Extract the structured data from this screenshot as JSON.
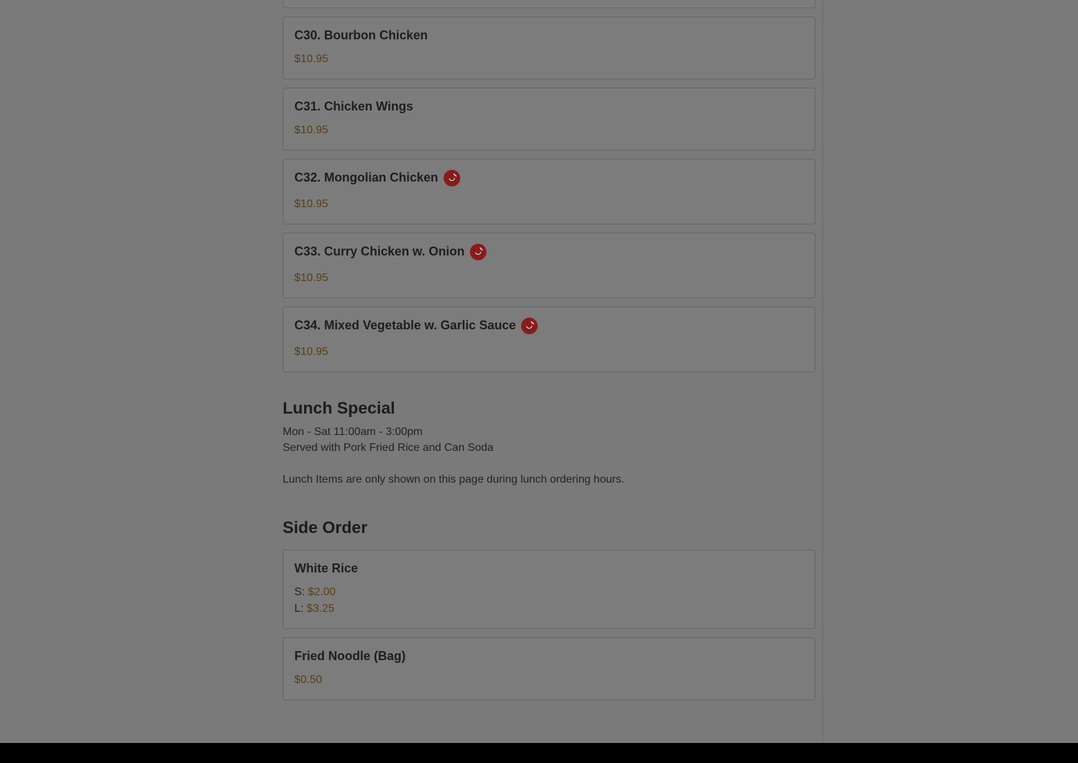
{
  "items": [
    {
      "name": "C30. Bourbon Chicken",
      "price": "$10.95",
      "spicy": false
    },
    {
      "name": "C31. Chicken Wings",
      "price": "$10.95",
      "spicy": false
    },
    {
      "name": "C32. Mongolian Chicken",
      "price": "$10.95",
      "spicy": true
    },
    {
      "name": "C33. Curry Chicken w. Onion",
      "price": "$10.95",
      "spicy": true
    },
    {
      "name": "C34. Mixed Vegetable w. Garlic Sauce",
      "price": "$10.95",
      "spicy": true
    }
  ],
  "lunch_special": {
    "title": "Lunch Special",
    "hours": "Mon - Sat 11:00am - 3:00pm",
    "served_with": "Served with Pork Fried Rice and Can Soda",
    "notice": "Lunch Items are only shown on this page during lunch ordering hours."
  },
  "side_order": {
    "title": "Side Order",
    "items": [
      {
        "name": "White Rice",
        "small_label": "S:",
        "small_price": "$2.00",
        "large_label": "L:",
        "large_price": "$3.25"
      },
      {
        "name": "Fried Noodle (Bag)",
        "price": "$0.50"
      }
    ]
  },
  "colors": {
    "overlay_bg": "#7a7a7a",
    "price": "#5a3d12",
    "spicy_icon": "#8b1a1a",
    "footer": "#000000"
  },
  "icons": {
    "spicy": "chili-pepper-icon"
  }
}
